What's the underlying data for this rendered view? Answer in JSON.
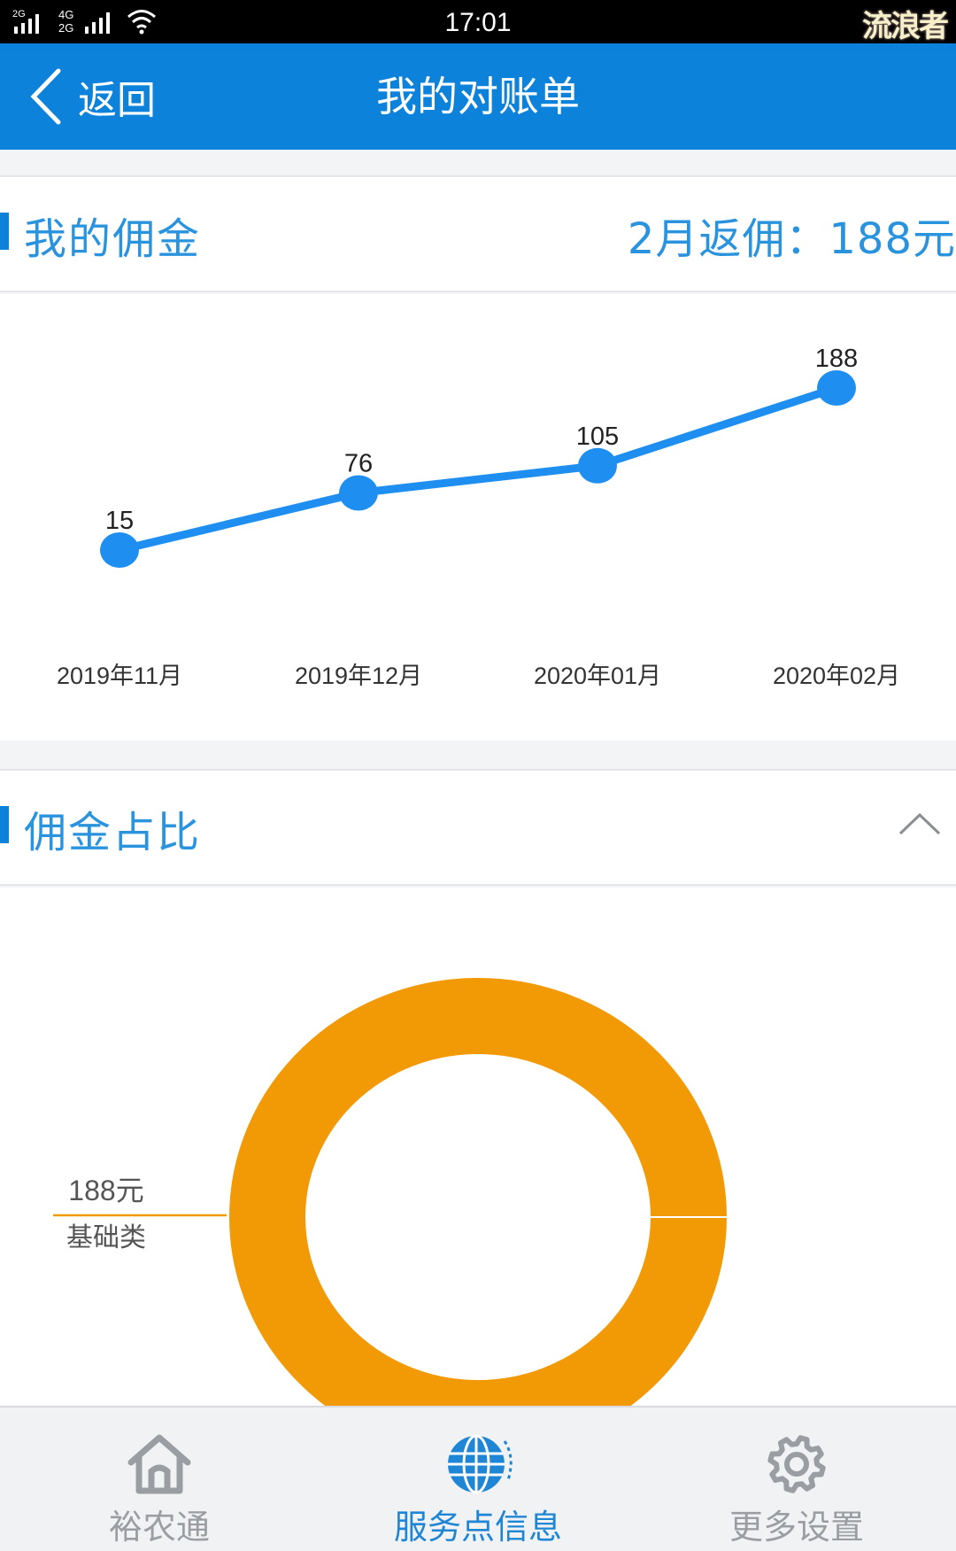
{
  "status_bar": {
    "signal_left": "2G",
    "signal_right": "4G",
    "signal_right_sub": "2G",
    "time": "17:01",
    "watermark": "流浪者"
  },
  "header": {
    "back_label": "返回",
    "title": "我的对账单"
  },
  "commission": {
    "title": "我的佣金",
    "summary": "2月返佣：188元"
  },
  "ratio": {
    "title": "佣金占比"
  },
  "chart_data": [
    {
      "type": "line",
      "categories": [
        "2019年11月",
        "2019年12月",
        "2020年01月",
        "2020年02月"
      ],
      "values": [
        15,
        76,
        105,
        188
      ],
      "data_labels": [
        "15",
        "76",
        "105",
        "188"
      ],
      "color": "#1e8ff0",
      "grid": false
    },
    {
      "type": "pie",
      "style": "donut",
      "slices": [
        {
          "label": "基础类",
          "value": 188,
          "value_text": "188元",
          "color": "#f29a06"
        }
      ]
    }
  ],
  "bottom_nav": {
    "items": [
      {
        "label": "裕农通",
        "icon": "home-icon",
        "active": false
      },
      {
        "label": "服务点信息",
        "icon": "globe-icon",
        "active": true
      },
      {
        "label": "更多设置",
        "icon": "gear-icon",
        "active": false
      }
    ],
    "active_color": "#1f86d6",
    "inactive_color": "#9a9ea3"
  }
}
